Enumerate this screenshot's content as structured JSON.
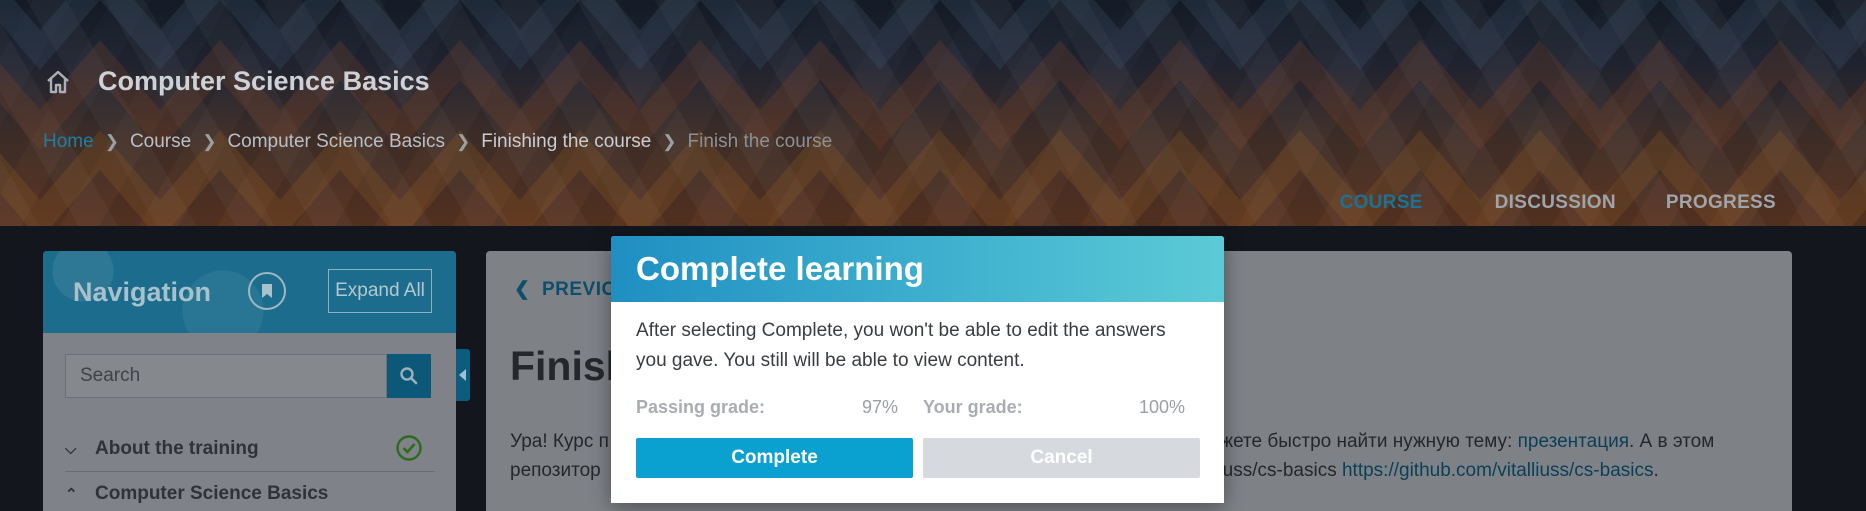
{
  "header": {
    "course_title": "Computer Science Basics",
    "breadcrumb": [
      "Home",
      "Course",
      "Computer Science Basics",
      "Finishing the course",
      "Finish the course"
    ],
    "tabs": [
      "COURSE",
      "DISCUSSION",
      "PROGRESS"
    ],
    "active_tab": "COURSE"
  },
  "sidebar": {
    "title": "Navigation",
    "expand_label": "Expand All",
    "search_placeholder": "Search",
    "items": [
      {
        "label": "About the training",
        "expanded": false,
        "completed": true
      },
      {
        "label": "Computer Science Basics",
        "expanded": true,
        "completed": false
      }
    ]
  },
  "main": {
    "prev_label": "PREVIO",
    "unit_title": "Finish",
    "line1_left": "Ура! Курс п",
    "line1_right": "ожете быстро найти нужную тему: ",
    "line1_link": "презентация",
    "line1_tail": ". А в этом",
    "line2_left": "репозитор",
    "line2_right": "lliuss/cs-basics ",
    "line2_link": "https://github.com/vitalliuss/cs-basics",
    "line2_tail": "."
  },
  "modal": {
    "title": "Complete learning",
    "message": "After selecting Complete, you won't be able to edit the answers you gave. You still will be able to view content.",
    "passing_label": "Passing grade:",
    "passing_value": "97%",
    "your_label": "Your grade:",
    "your_value": "100%",
    "complete_label": "Complete",
    "cancel_label": "Cancel"
  },
  "colors": {
    "accent": "#0aa0cf",
    "header_gradient_start": "#1f8fc2",
    "header_gradient_end": "#5ccad6",
    "check": "#2f6b1f"
  }
}
